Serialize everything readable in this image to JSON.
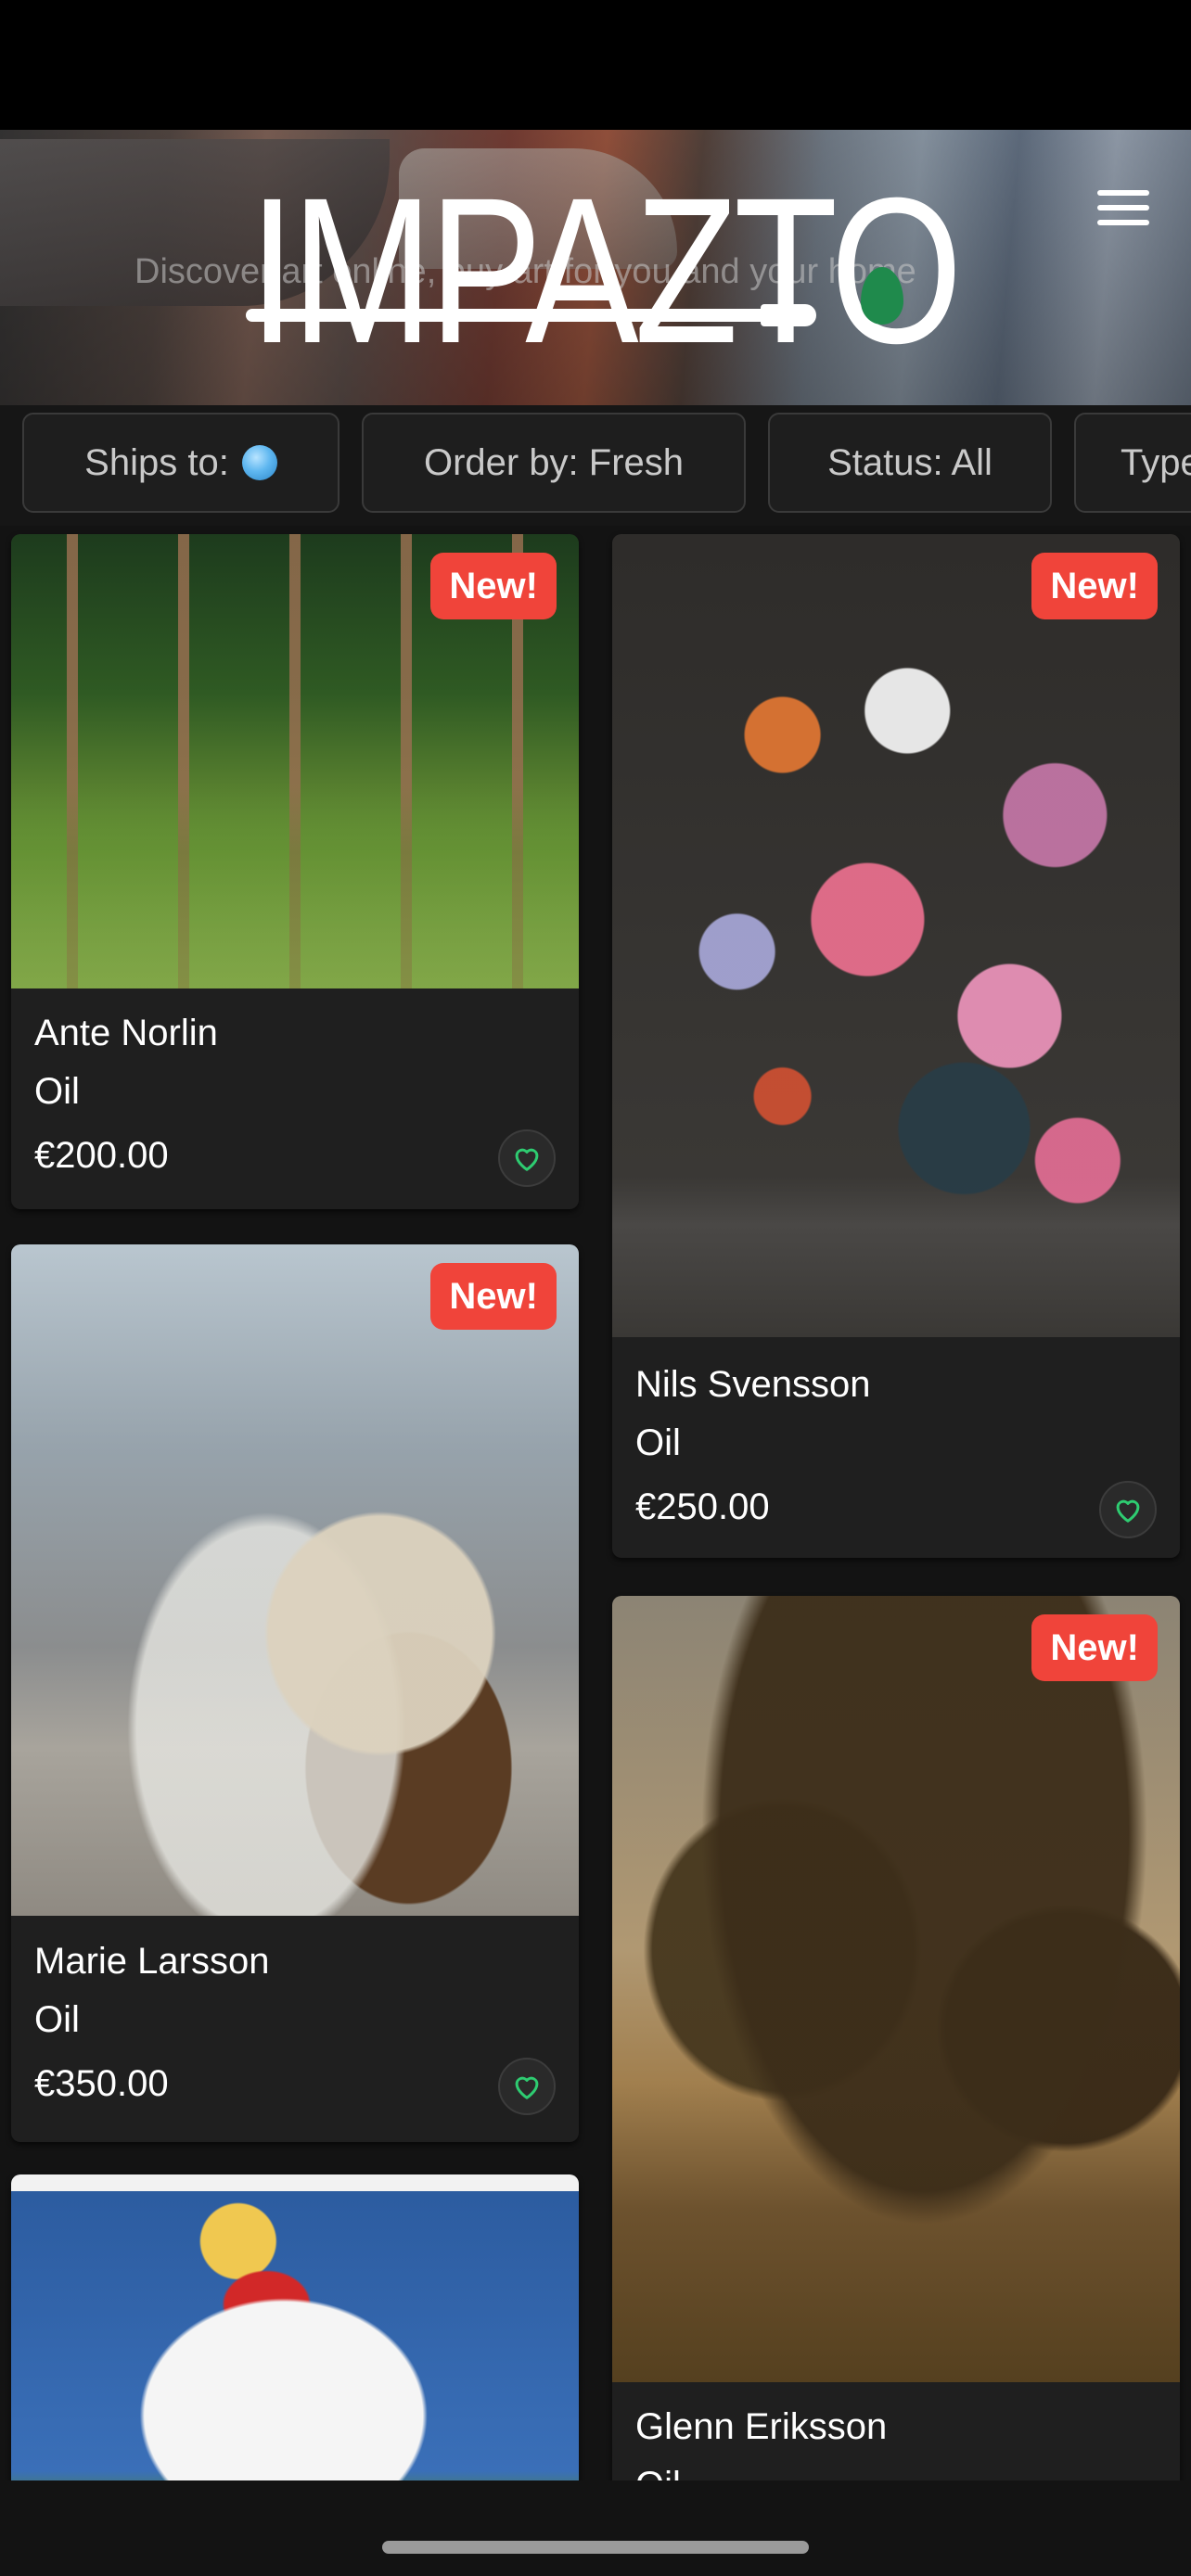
{
  "header": {
    "logo_text": "IMPAZTO",
    "tagline": "Discover art online, buy art for you and your home"
  },
  "filters": [
    {
      "label": "Ships to:",
      "icon": "globe-icon"
    },
    {
      "label": "Order by: Fresh"
    },
    {
      "label": "Status: All"
    },
    {
      "label": "Type"
    }
  ],
  "badge_label": "New!",
  "artworks": [
    {
      "artist": "Ante Norlin",
      "medium": "Oil",
      "price": "€200.00",
      "new": true
    },
    {
      "artist": "Nils Svensson",
      "medium": "Oil",
      "price": "€250.00",
      "new": true
    },
    {
      "artist": "Marie Larsson",
      "medium": "Oil",
      "price": "€350.00",
      "new": true
    },
    {
      "artist": "Glenn Eriksson",
      "medium": "Oil",
      "price": "",
      "new": true
    },
    {
      "artist": "",
      "medium": "",
      "price": "",
      "new": false
    }
  ],
  "colors": {
    "background": "#131313",
    "card": "#1f1f1f",
    "badge": "#f0443a",
    "favorite_accent": "#2ecc71",
    "logo_drop": "#1f8a4c"
  }
}
